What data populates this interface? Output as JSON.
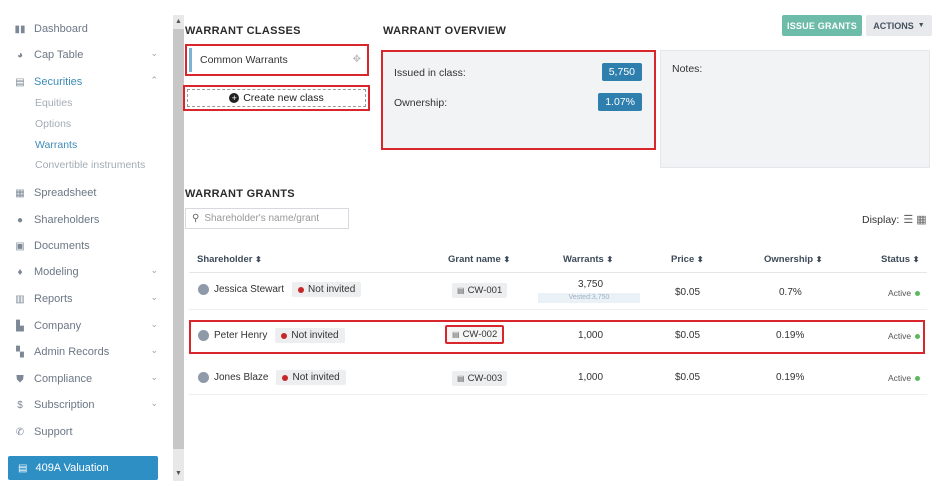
{
  "sidebar": {
    "items": [
      {
        "label": "Dashboard",
        "icon": "bars-icon",
        "has_chevron": false
      },
      {
        "label": "Cap Table",
        "icon": "pie-chart-icon",
        "has_chevron": true
      },
      {
        "label": "Securities",
        "icon": "clipboard-icon",
        "has_chevron": true,
        "expanded": true
      },
      {
        "label": "Spreadsheet",
        "icon": "spreadsheet-icon",
        "has_chevron": false
      },
      {
        "label": "Shareholders",
        "icon": "user-icon",
        "has_chevron": false
      },
      {
        "label": "Documents",
        "icon": "folder-icon",
        "has_chevron": false
      },
      {
        "label": "Modeling",
        "icon": "bulb-icon",
        "has_chevron": true
      },
      {
        "label": "Reports",
        "icon": "report-icon",
        "has_chevron": true
      },
      {
        "label": "Company",
        "icon": "building-icon",
        "has_chevron": true
      },
      {
        "label": "Admin Records",
        "icon": "records-icon",
        "has_chevron": true
      },
      {
        "label": "Compliance",
        "icon": "shield-icon",
        "has_chevron": true
      },
      {
        "label": "Subscription",
        "icon": "dollar-icon",
        "has_chevron": true
      },
      {
        "label": "Support",
        "icon": "support-icon",
        "has_chevron": false
      }
    ],
    "sub_items": [
      "Equities",
      "Options",
      "Warrants",
      "Convertible instruments"
    ],
    "active_sub": "Warrants",
    "valuation_label": "409A Valuation"
  },
  "classes": {
    "title": "WARRANT CLASSES",
    "items": [
      "Common Warrants"
    ],
    "create_label": "Create new class"
  },
  "overview": {
    "title": "WARRANT OVERVIEW",
    "issued_label": "Issued in class:",
    "issued_value": "5,750",
    "ownership_label": "Ownership:",
    "ownership_value": "1.07%",
    "notes_label": "Notes:"
  },
  "actions": {
    "issue_label": "ISSUE GRANTS",
    "actions_label": "ACTIONS"
  },
  "grants": {
    "title": "WARRANT GRANTS",
    "search_placeholder": "Shareholder's name/grant",
    "display_label": "Display:",
    "columns": [
      "Shareholder",
      "Grant name",
      "Warrants",
      "Price",
      "Ownership",
      "Status"
    ],
    "rows": [
      {
        "name": "Jessica Stewart",
        "invite": "Not invited",
        "grant": "CW-001",
        "warrants": "3,750",
        "vested": "Vested:3,750",
        "price": "$0.05",
        "ownership": "0.7%",
        "status": "Active"
      },
      {
        "name": "Peter Henry",
        "invite": "Not invited",
        "grant": "CW-002",
        "warrants": "1,000",
        "vested": "",
        "price": "$0.05",
        "ownership": "0.19%",
        "status": "Active"
      },
      {
        "name": "Jones Blaze",
        "invite": "Not invited",
        "grant": "CW-003",
        "warrants": "1,000",
        "vested": "",
        "price": "$0.05",
        "ownership": "0.19%",
        "status": "Active"
      }
    ]
  }
}
